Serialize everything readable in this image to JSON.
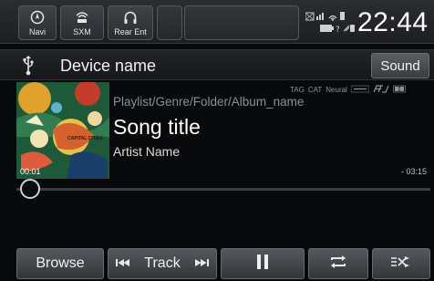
{
  "topbar": {
    "buttons": [
      {
        "label": "Navi",
        "icon": "navi-icon"
      },
      {
        "label": "SXM",
        "icon": "sxm-icon"
      },
      {
        "label": "Rear Ent",
        "icon": "headphones-icon"
      }
    ],
    "clock": "22:44"
  },
  "source": {
    "device_name": "Device name",
    "sound_label": "Sound"
  },
  "now_playing": {
    "tags": [
      "TAG",
      "CAT",
      "Neural"
    ],
    "breadcrumb": "Playlist/Genre/Folder/Album_name",
    "song_title": "Song title",
    "artist": "Artist Name",
    "elapsed": "00:01",
    "remaining": "- 03:15",
    "album_art_text": "CAPITAL CITIES",
    "progress_fraction": 0.005
  },
  "controls": {
    "browse_label": "Browse",
    "track_label": "Track",
    "prev_icon": "previous-track-icon",
    "next_icon": "next-track-icon",
    "pause_icon": "pause-icon",
    "repeat_icon": "repeat-icon",
    "shuffle_icon": "shuffle-icon"
  }
}
